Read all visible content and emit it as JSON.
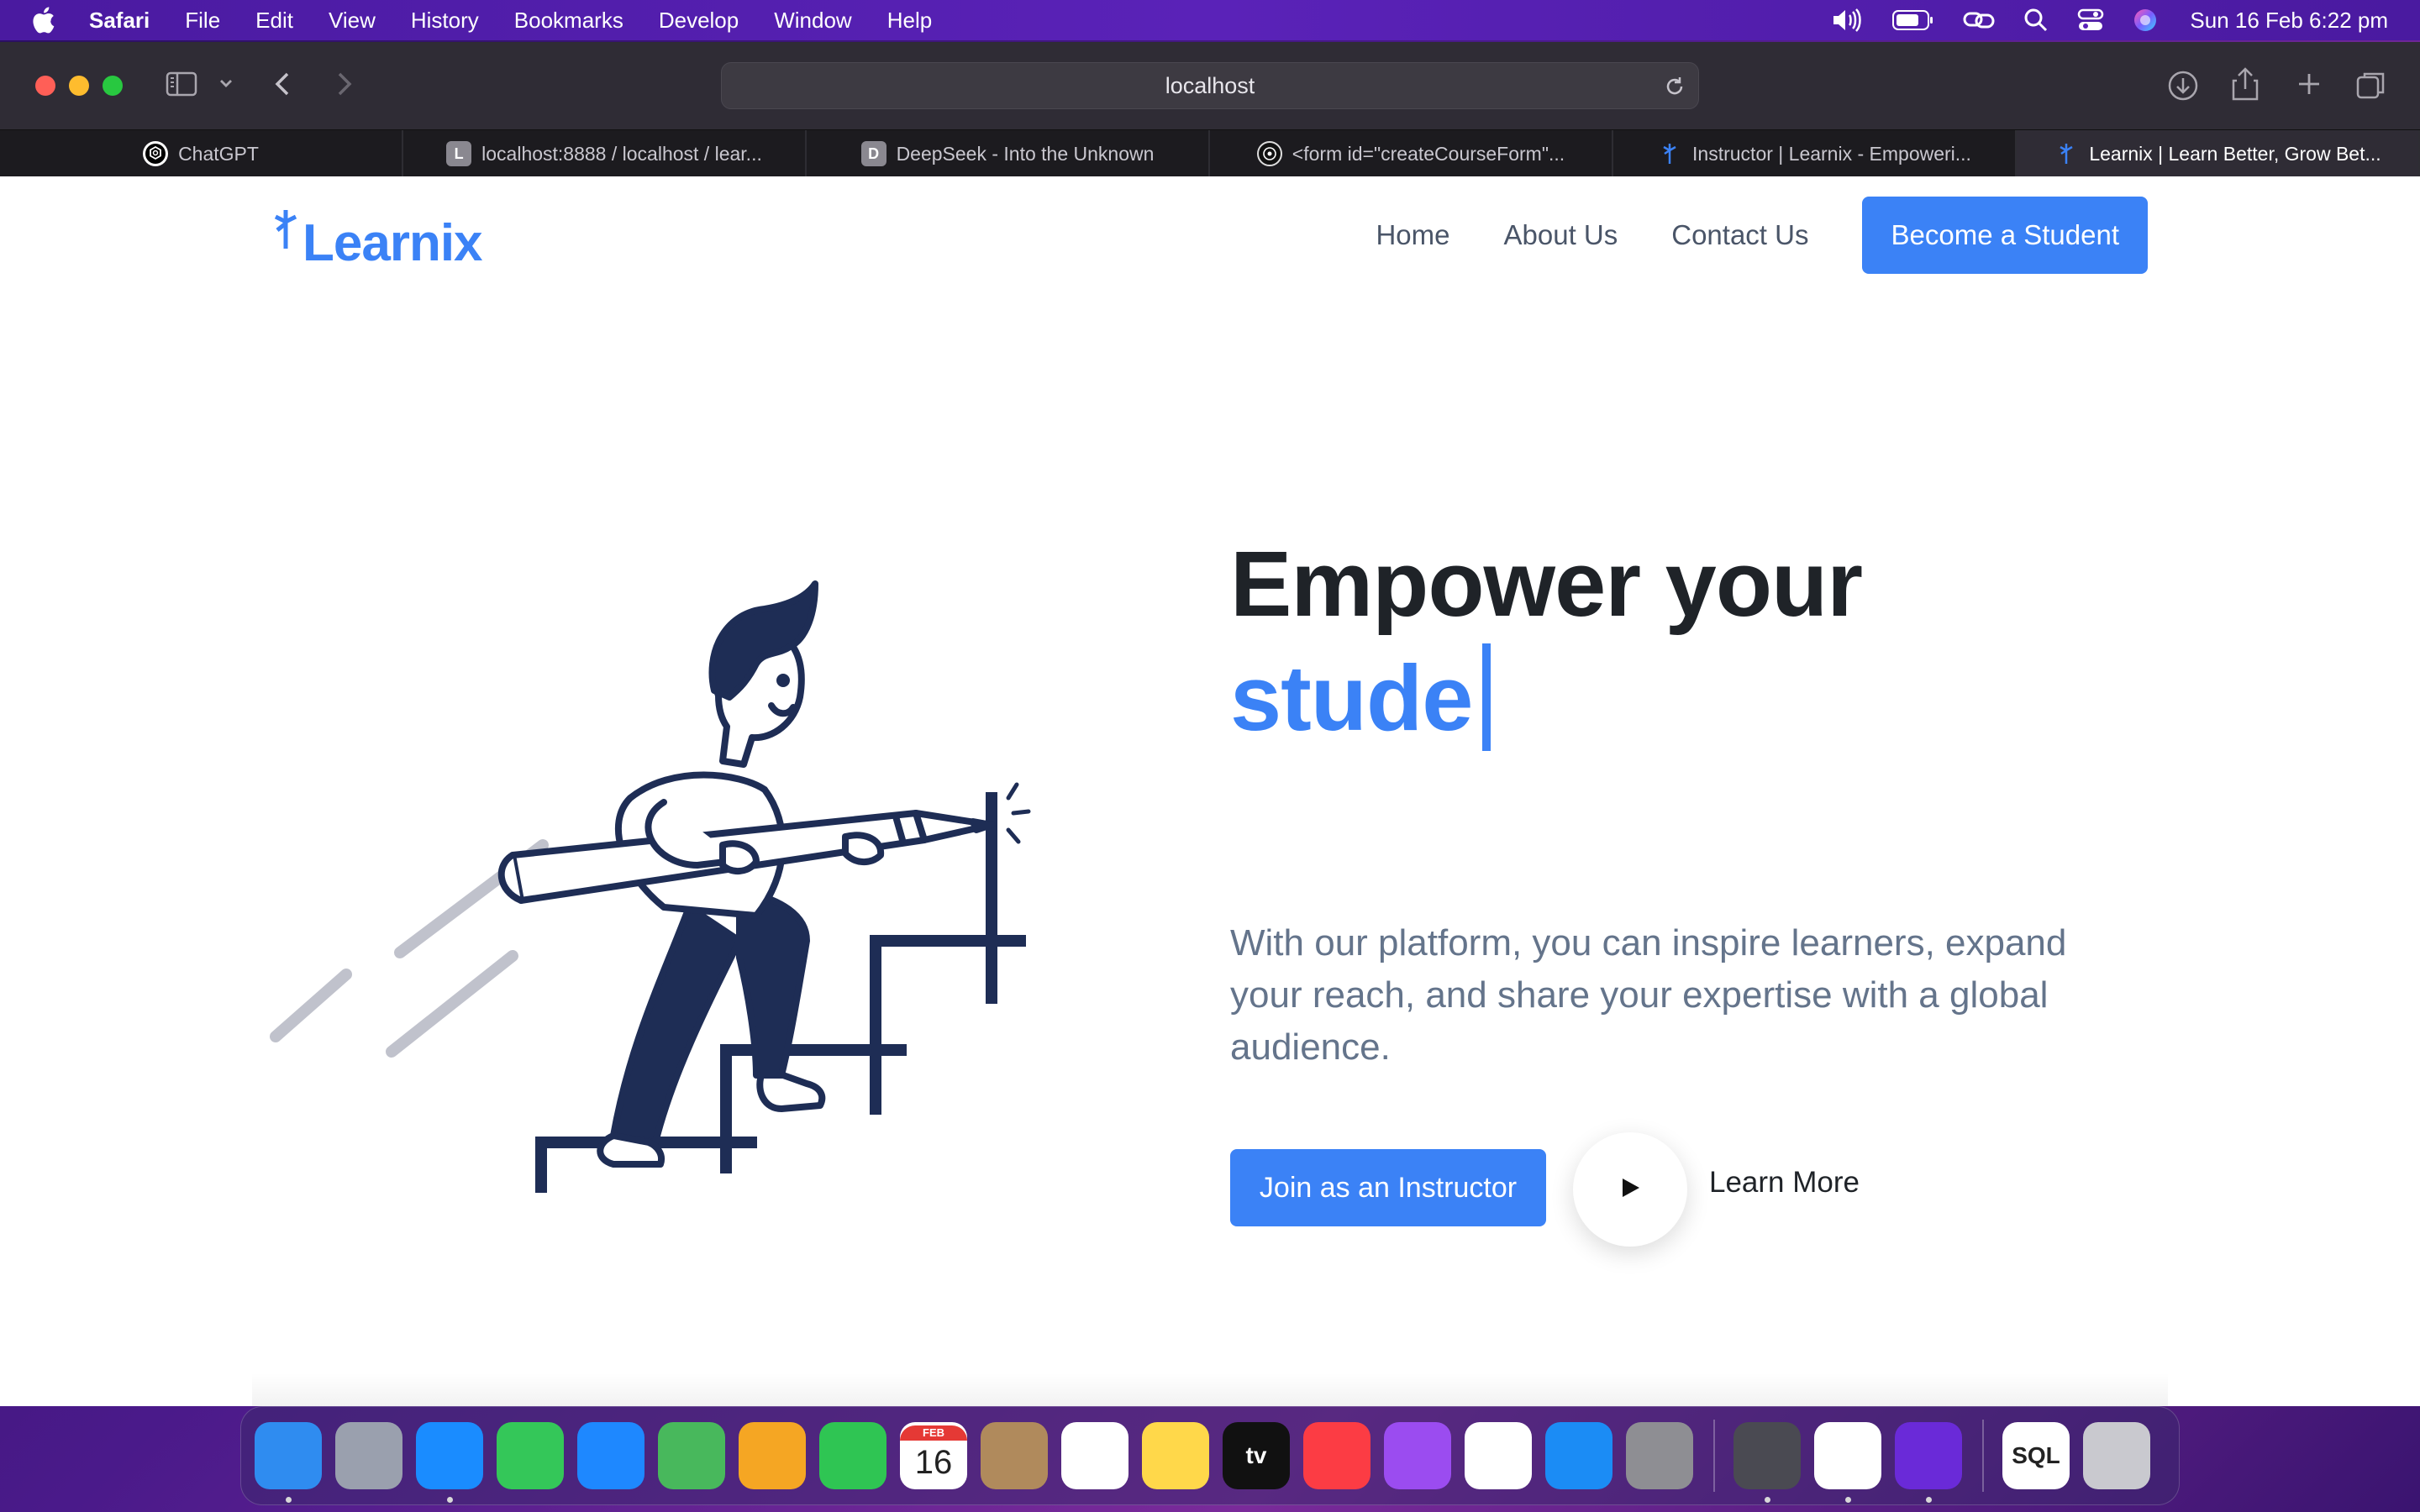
{
  "menubar": {
    "app_name": "Safari",
    "menus": [
      "File",
      "Edit",
      "View",
      "History",
      "Bookmarks",
      "Develop",
      "Window",
      "Help"
    ],
    "clock": "Sun 16 Feb  6:22 pm",
    "status_icons": [
      "volume-icon",
      "battery-icon",
      "link-icon",
      "search-icon",
      "control-center-icon",
      "siri-icon"
    ]
  },
  "browser": {
    "url": "localhost",
    "tabs": [
      {
        "label": "ChatGPT",
        "favicon": "chatgpt-icon"
      },
      {
        "label": "localhost:8888 / localhost / lear...",
        "favicon": "L"
      },
      {
        "label": "DeepSeek - Into the Unknown",
        "favicon": "D"
      },
      {
        "label": "<form id=\"createCourseForm\"...",
        "favicon": "form-icon"
      },
      {
        "label": "Instructor | Learnix - Empoweri...",
        "favicon": "learnix-icon"
      },
      {
        "label": "Learnix | Learn Better, Grow Bet...",
        "favicon": "learnix-icon",
        "active": true
      }
    ]
  },
  "site": {
    "logo": "Learnix",
    "nav": {
      "home": "Home",
      "about": "About Us",
      "contact": "Contact Us",
      "cta": "Become a Student"
    },
    "hero": {
      "title_line1": "Empower your",
      "title_typed": "stude",
      "description": "With our platform, you can inspire learners, expand your reach, and share your expertise with a global audience.",
      "primary_button": "Join as an Instructor",
      "secondary_link": "Learn More"
    },
    "colors": {
      "accent": "#3b82f6",
      "heading": "#1f2328",
      "muted": "#64748b",
      "illustration": "#1e2d55"
    }
  },
  "dock": {
    "apps": [
      {
        "name": "Finder",
        "color": "#2f8cf0",
        "running": true
      },
      {
        "name": "Launchpad",
        "color": "#9aa0ae",
        "running": false
      },
      {
        "name": "Safari",
        "color": "#1a8cff",
        "running": true
      },
      {
        "name": "Messages",
        "color": "#34c759",
        "running": false
      },
      {
        "name": "Mail",
        "color": "#1e88ff",
        "running": false
      },
      {
        "name": "Maps",
        "color": "#48b85c",
        "running": false
      },
      {
        "name": "Photos",
        "color": "#f5a623",
        "running": false
      },
      {
        "name": "FaceTime",
        "color": "#2fc553",
        "running": false
      },
      {
        "name": "Calendar",
        "color": "#ffffff",
        "label": "16",
        "sublabel": "FEB",
        "running": false
      },
      {
        "name": "Contacts",
        "color": "#b08a5c",
        "running": false
      },
      {
        "name": "Reminders",
        "color": "#ffffff",
        "running": false
      },
      {
        "name": "Notes",
        "color": "#ffd84a",
        "running": false
      },
      {
        "name": "Apple TV",
        "color": "#111111",
        "label": "tv",
        "running": false
      },
      {
        "name": "Music",
        "color": "#fc3c44",
        "running": false
      },
      {
        "name": "Podcasts",
        "color": "#9b4cf0",
        "running": false
      },
      {
        "name": "News",
        "color": "#ffffff",
        "running": false
      },
      {
        "name": "App Store",
        "color": "#1b8cf5",
        "running": false
      },
      {
        "name": "System Settings",
        "color": "#8e8e93",
        "running": false
      },
      {
        "name": "TablePlus",
        "color": "#4a4a52",
        "running": true
      },
      {
        "name": "VS Code",
        "color": "#ffffff",
        "running": true
      },
      {
        "name": "Firefox",
        "color": "#6a2ad8",
        "running": true
      },
      {
        "name": "SQL File",
        "color": "#ffffff",
        "label": "SQL",
        "running": false
      },
      {
        "name": "Trash",
        "color": "#c9c9cf",
        "running": false
      }
    ]
  }
}
